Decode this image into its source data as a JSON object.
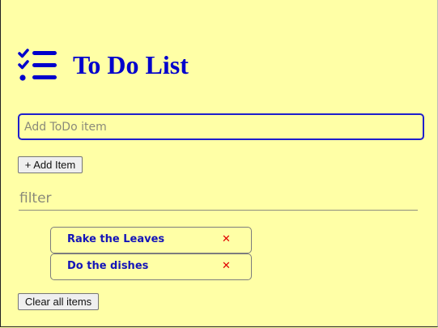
{
  "header": {
    "title": "To Do List",
    "icon": "list-check-icon",
    "accent_color": "#0000cc"
  },
  "add_form": {
    "input_placeholder": "Add ToDo item",
    "input_value": "",
    "add_button_label": "+ Add Item"
  },
  "filter": {
    "placeholder": "filter",
    "value": ""
  },
  "todos": [
    {
      "text": "Rake the Leaves",
      "delete_icon": "✕"
    },
    {
      "text": "Do the dishes",
      "delete_icon": "✕"
    }
  ],
  "footer": {
    "clear_button_label": "Clear all items"
  },
  "colors": {
    "background": "#ffffa6",
    "item_text": "#1414b8",
    "delete": "#e00000"
  }
}
